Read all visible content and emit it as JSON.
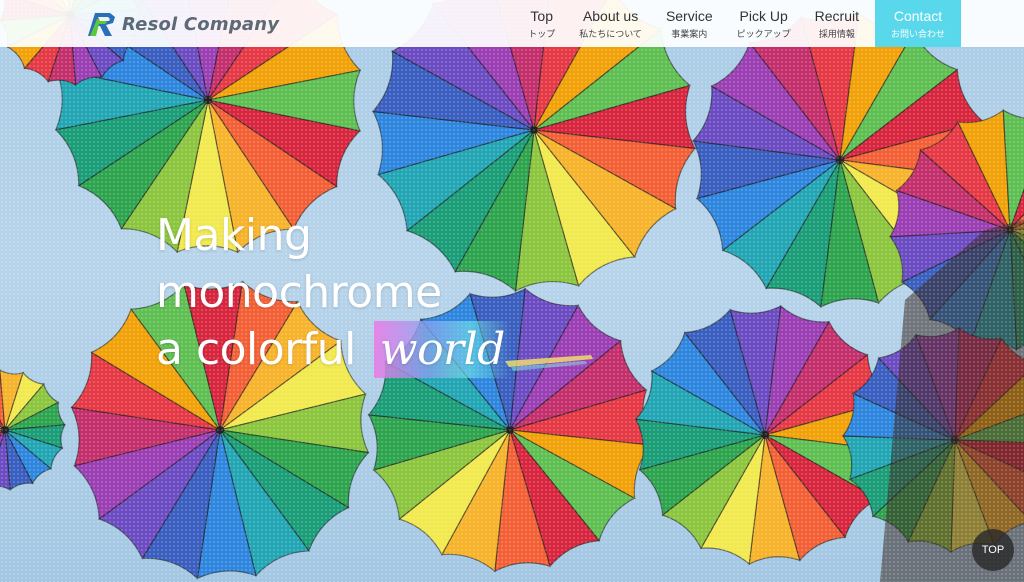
{
  "brand": {
    "name": "Resol Company",
    "logo_letter": "R",
    "colors": {
      "logo_blue": "#2a6fb8",
      "logo_green": "#5cc83a",
      "text_gray": "#5d6a76"
    }
  },
  "nav": {
    "items": [
      {
        "en": "Top",
        "ja": "トップ"
      },
      {
        "en": "About us",
        "ja": "私たちについて"
      },
      {
        "en": "Service",
        "ja": "事業案内"
      },
      {
        "en": "Pick Up",
        "ja": "ピックアップ"
      },
      {
        "en": "Recruit",
        "ja": "採用情報"
      }
    ],
    "contact": {
      "en": "Contact",
      "ja": "お問い合わせ",
      "color": "#58d8ea"
    }
  },
  "hero": {
    "line1": "Making",
    "line2": "monochrome",
    "line3": "a colorful",
    "accent_word": "world",
    "image_description": "colorful umbrellas"
  },
  "top_button": {
    "label": "TOP"
  }
}
